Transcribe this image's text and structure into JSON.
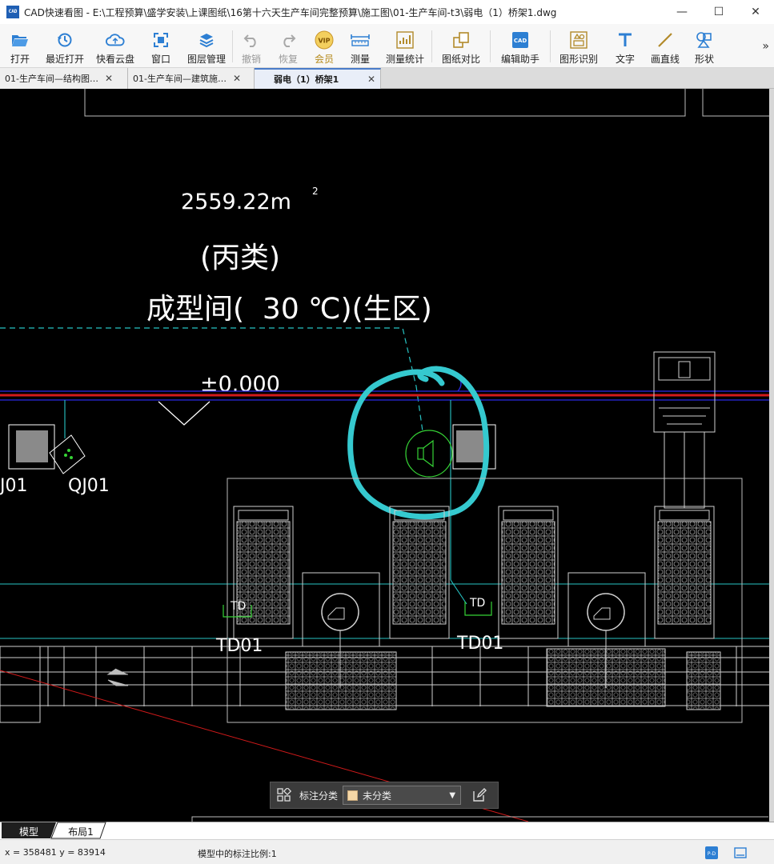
{
  "window": {
    "title": "CAD快速看图 - E:\\工程预算\\盛学安装\\上课图纸\\16第十六天生产车间完整预算\\施工图\\01-生产车间-t3\\弱电（1）桥架1.dwg",
    "app_icon_text": "CAD",
    "minimize": "—",
    "maximize": "☐",
    "close": "✕"
  },
  "toolbar": {
    "open": "打开",
    "recent": "最近打开",
    "cloud": "快看云盘",
    "window": "窗口",
    "layers": "图层管理",
    "undo": "撤销",
    "redo": "恢复",
    "vip": "会员",
    "measure": "测量",
    "measure_stats": "测量统计",
    "compare": "图纸对比",
    "edit_helper": "编辑助手",
    "shape_recog": "图形识别",
    "text": "文字",
    "line": "画直线",
    "shape": "形状",
    "more": "»"
  },
  "tabs": [
    {
      "label": "01-生产车间—结构图…",
      "close": "✕"
    },
    {
      "label": "01-生产车间—建筑施…",
      "close": "✕"
    },
    {
      "label": "弱电（1）桥架1",
      "close": "✕",
      "active": true
    }
  ],
  "drawing": {
    "area_text": "2559.22m",
    "area_sup": "2",
    "class_text": "(丙类)",
    "room_text": "成型间(  30 ℃)(生区)",
    "elevation": "±0.000",
    "label_qj01_left": "J01",
    "label_qj01": "QJ01",
    "label_td_1": "TD",
    "label_td01_1": "TD01",
    "label_td_2": "TD",
    "label_td01_2": "TD01"
  },
  "annotation_bar": {
    "label": "标注分类",
    "selected": "未分类"
  },
  "layout_tabs": {
    "model": "模型",
    "layout1": "布局1"
  },
  "status": {
    "coords": "x = 358481  y = 83914",
    "scale": "模型中的标注比例:1"
  },
  "colors": {
    "canvas_bg": "#000000",
    "highlight_circle": "#35c9cf",
    "red_line": "#d21a1a",
    "blue_line": "#2a2ae6",
    "cyan_line": "#27c4c4",
    "green": "#35d335"
  }
}
